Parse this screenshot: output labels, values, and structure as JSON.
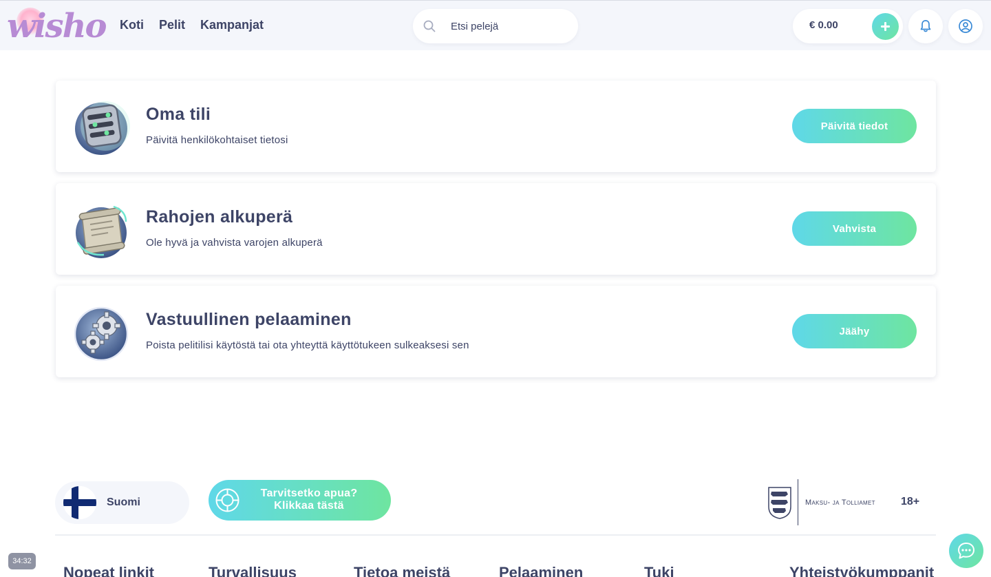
{
  "header": {
    "logo_text": "wisho",
    "nav": [
      "Koti",
      "Pelit",
      "Kampanjat"
    ],
    "search_placeholder": "Etsi pelejä",
    "balance": "€ 0.00"
  },
  "cards": [
    {
      "title": "Oma tili",
      "description": "Päivitä henkilökohtaiset tietosi",
      "button": "Päivitä tiedot",
      "icon": "account-settings-icon"
    },
    {
      "title": "Rahojen alkuperä",
      "description": "Ole hyvä ja vahvista varojen alkuperä",
      "button": "Vahvista",
      "icon": "scroll-document-icon"
    },
    {
      "title": "Vastuullinen pelaaminen",
      "description": "Poista pelitilisi käytöstä tai ota yhteyttä käyttötukeen sulkeaksesi sen",
      "button": "Jäähy",
      "icon": "gears-icon"
    }
  ],
  "footer": {
    "language": "Suomi",
    "help_line1": "Tarvitsetko apua?",
    "help_line2": "Klikkaa tästä",
    "regulator": "Maksu- ja Tolliamet",
    "age_limit": "18+",
    "headings": [
      "Nopeat linkit",
      "Turvallisuus",
      "Tietoa meistä",
      "Pelaaminen",
      "Tuki",
      "Yhteistyökumppanit"
    ],
    "timer": "34:32"
  },
  "colors": {
    "accent_gradient_start": "#5fd8e8",
    "accent_gradient_end": "#6ee5a0",
    "text": "#3d4466",
    "header_bg": "#f4f6fb"
  }
}
